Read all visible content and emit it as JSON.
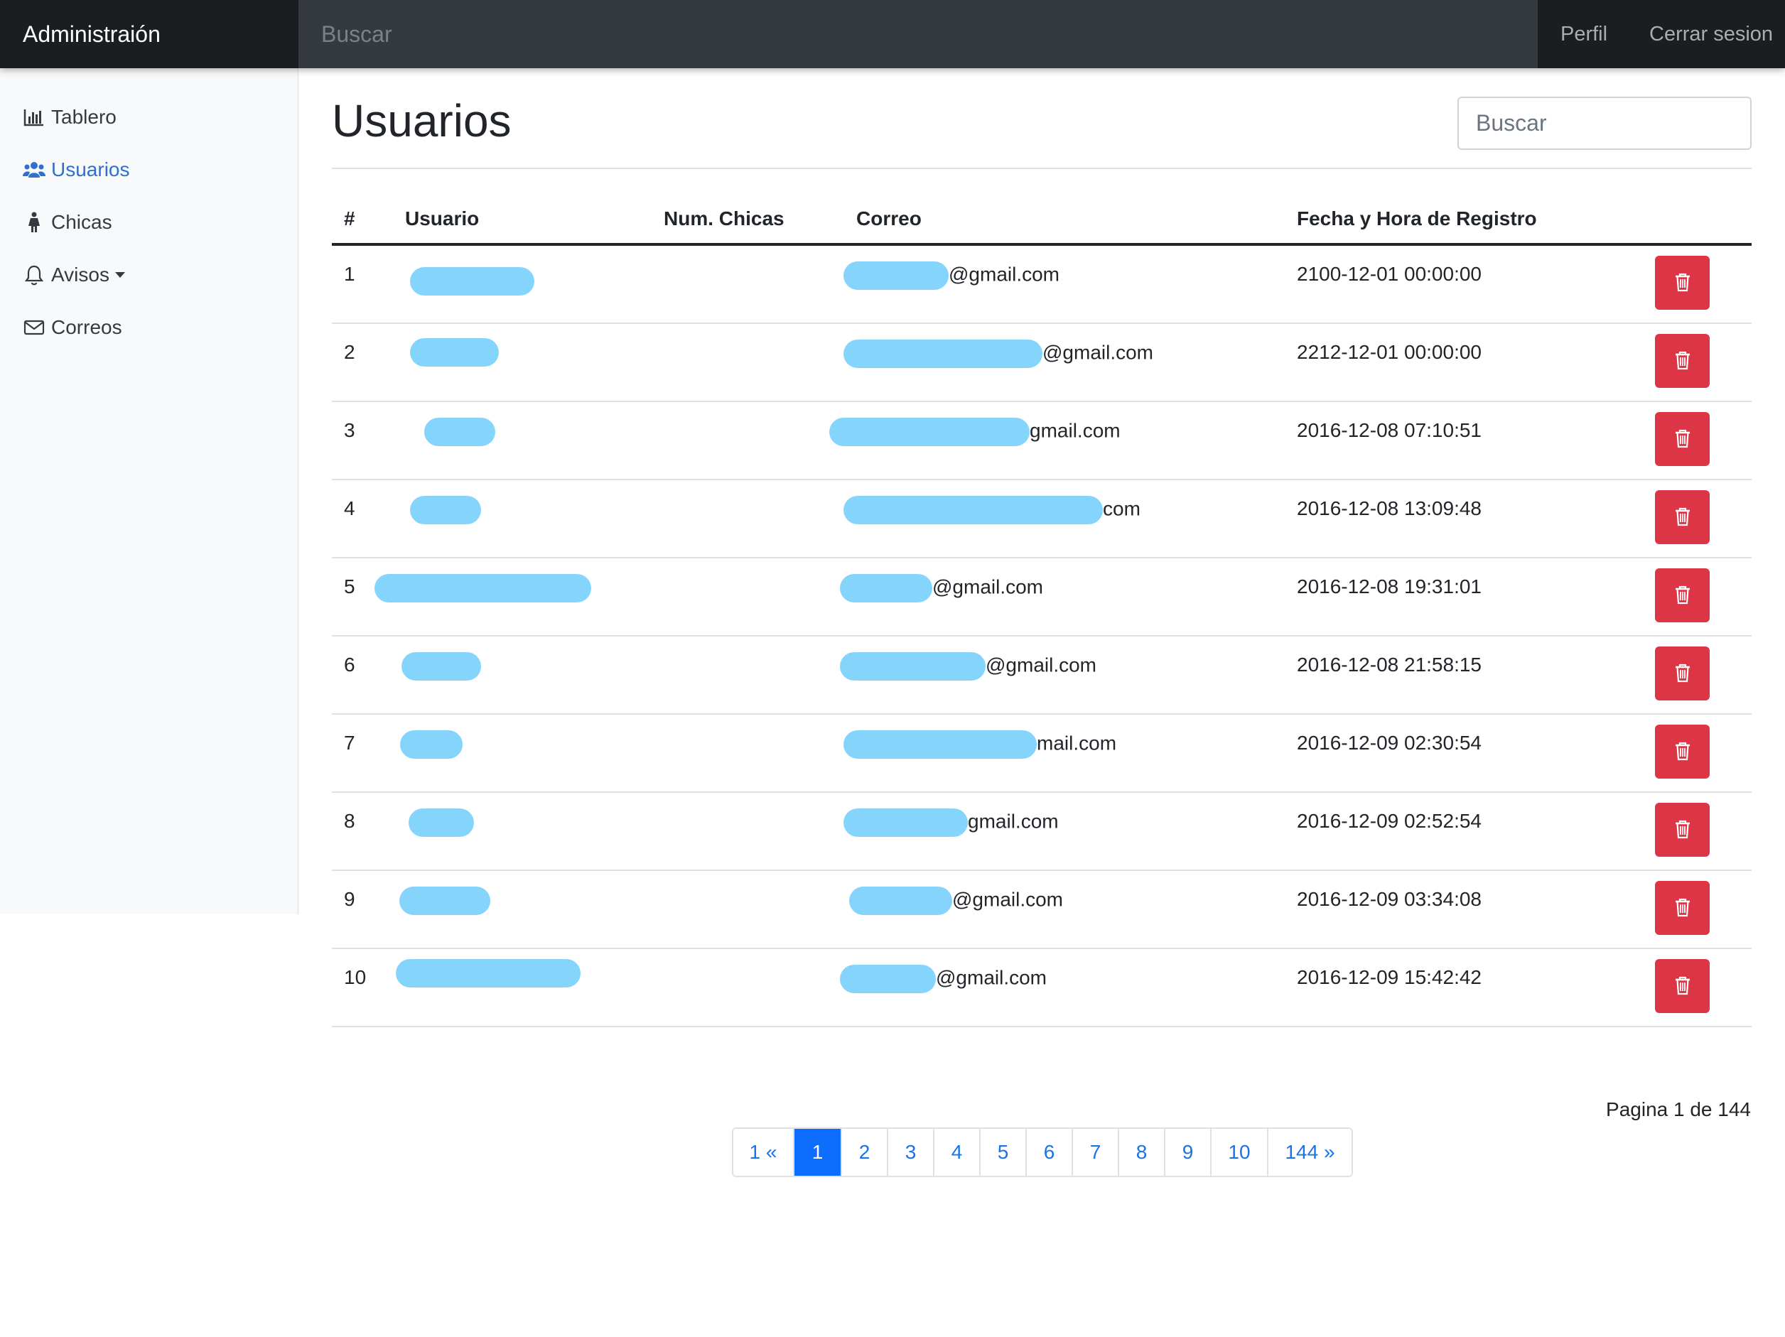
{
  "navbar": {
    "brand": "Administraión",
    "search_placeholder": "Buscar",
    "profile": "Perfil",
    "logout": "Cerrar sesion"
  },
  "sidebar": {
    "items": [
      {
        "label": "Tablero",
        "icon": "bar-chart-icon",
        "active": false
      },
      {
        "label": "Usuarios",
        "icon": "users-icon",
        "active": true
      },
      {
        "label": "Chicas",
        "icon": "female-icon",
        "active": false
      },
      {
        "label": "Avisos",
        "icon": "bell-icon",
        "active": false
      },
      {
        "label": "Correos",
        "icon": "envelope-icon",
        "active": false
      }
    ]
  },
  "main": {
    "title": "Usuarios",
    "search_placeholder": "Buscar",
    "table": {
      "headers": [
        "#",
        "Usuario",
        "Num. Chicas",
        "Correo",
        "Fecha y Hora de Registro"
      ],
      "rows": [
        {
          "num": "1",
          "email": "@gmail.com",
          "date": "2100-12-01 00:00:00"
        },
        {
          "num": "2",
          "email": "@gmail.com",
          "date": "2212-12-01 00:00:00"
        },
        {
          "num": "3",
          "email": "gmail.com",
          "date": "2016-12-08 07:10:51"
        },
        {
          "num": "4",
          "email": "com",
          "date": "2016-12-08 13:09:48"
        },
        {
          "num": "5",
          "email": "@gmail.com",
          "date": "2016-12-08 19:31:01"
        },
        {
          "num": "6",
          "email": "@gmail.com",
          "date": "2016-12-08 21:58:15"
        },
        {
          "num": "7",
          "email": "mail.com",
          "date": "2016-12-09 02:30:54"
        },
        {
          "num": "8",
          "email": "gmail.com",
          "date": "2016-12-09 02:52:54"
        },
        {
          "num": "9",
          "email": "@gmail.com",
          "date": "2016-12-09 03:34:08"
        },
        {
          "num": "10",
          "email": "@gmail.com",
          "date": "2016-12-09 15:42:42"
        }
      ],
      "delete_icon": "trash-icon"
    },
    "pagination": {
      "info": "Pagina 1 de 144",
      "pages": [
        "1 «",
        "1",
        "2",
        "3",
        "4",
        "5",
        "6",
        "7",
        "8",
        "9",
        "10",
        "144 »"
      ],
      "active_index": 1
    }
  },
  "colors": {
    "navbar_bg": "#343a40",
    "brand_bg": "#1b1e21",
    "sidebar_bg": "#f8f9fa",
    "active_link": "#2f6fcf",
    "danger": "#dc3545",
    "page_active": "#0d6efd",
    "redaction": "#84d4fc"
  }
}
